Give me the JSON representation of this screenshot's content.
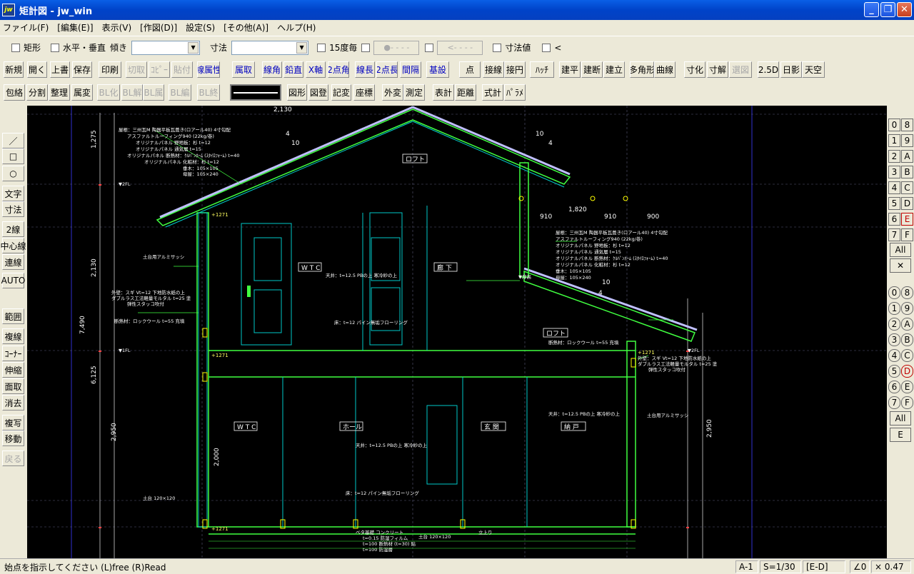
{
  "window": {
    "icon_label": "jw",
    "title": "矩計図 - jw_win",
    "min": "_",
    "max": "❐",
    "close": "✕"
  },
  "menu": [
    "ファイル(F)",
    "[編集(E)]",
    "表示(V)",
    "[作図(D)]",
    "設定(S)",
    "[その他(A)]",
    "ヘルプ(H)"
  ],
  "row1": {
    "kukei": "矩形",
    "suihei": "水平・垂直",
    "katamuki": "傾き",
    "sunpo": "寸法",
    "deg15": "15度毎",
    "dis1": "●- - - -",
    "dis2": "<- - - -",
    "sunpochi": "寸法値",
    "lt": "<"
  },
  "toolbar2": [
    "新規",
    "開く",
    "上書",
    "保存",
    "印刷",
    "切取",
    "ｺﾋﾟｰ",
    "貼付",
    "線属性",
    "属取",
    "線角",
    "鉛直",
    "X軸",
    "2点角",
    "線長",
    "2点長",
    "間隔",
    "基設",
    "点",
    "接線",
    "接円",
    "ﾊｯﾁ",
    "建平",
    "建断",
    "建立",
    "多角形",
    "曲線",
    "寸化",
    "寸解",
    "選図",
    "2.5D",
    "日影",
    "天空"
  ],
  "toolbar3": [
    "包絡",
    "分割",
    "整理",
    "属変",
    "BL化",
    "BL解",
    "BL属",
    "BL編",
    "BL終",
    "図形",
    "図登",
    "記変",
    "座標",
    "外変",
    "測定",
    "表計",
    "距離",
    "式計",
    "ﾊﾟﾗﾒ"
  ],
  "leftbar": [
    "／",
    "□",
    "○",
    "文字",
    "寸法",
    "2線",
    "中心線",
    "連線",
    "AUTO",
    "範囲",
    "複線",
    "ｺｰﾅｰ",
    "伸縮",
    "面取",
    "消去",
    "複写",
    "移動",
    "戻る"
  ],
  "layers": {
    "groups_a": [
      "0",
      "1",
      "2",
      "3",
      "4",
      "5",
      "6",
      "7"
    ],
    "groups_b": [
      "8",
      "9",
      "A",
      "B",
      "C",
      "D",
      "E",
      "F"
    ],
    "all_label": "All",
    "x_label": "✕",
    "e_label": "E"
  },
  "drawing": {
    "dim_top": "2,130",
    "dim_left_1": "1,275",
    "dim_left_2": "2,130",
    "dim_left_3": "7,490",
    "dim_left_4": "6,125",
    "dim_left_5": "2,950",
    "dim_left_6": "2,000",
    "dim_right_1": "910",
    "dim_right_2": "910",
    "dim_right_3": "900",
    "dim_1820": "1,820",
    "dim_right_v": "2,950",
    "slope1": "4",
    "slope2": "10",
    "slope3": "10",
    "slope4": "4",
    "slope5": "10",
    "slope6": "4",
    "room_wtc_up": "W T C",
    "room_roka": "廊 下",
    "room_loft_top": "ロフト",
    "room_loft_right": "ロフト",
    "room_wtc_down": "W T C",
    "room_hall": "ホール",
    "room_genkan1": "玄 関",
    "room_genkan2": "納 戸",
    "note_roof": "屋根：三州瓦M 陶器平板瓦葺き(ロアール40) 4寸勾配",
    "note_roof2": "アスファルトルーフィング940 (22kg/巻)",
    "note_roof3": "オリジナルパネル 野地板：杉 t=12",
    "note_roof4": "オリジナルパネル 通気層 t=15",
    "note_roof5": "オリジナルパネル 断熱材：ｸﾙﾊﾟﾝﾎｰﾑ (ｽﾀｲﾛﾌｫｰﾑ) t=40",
    "note_roof6": "オリジナルパネル 化粧材：杉 t=12",
    "note_roof7": "垂木：105×105",
    "note_roof8": "母屋：105×240",
    "note_fl1": "▼1FL",
    "note_fl2": "▼2FL",
    "note_fl_r": "▼2FL",
    "note_sash": "土台用アルミサッシ",
    "note_wall": "外壁：スギ Vt=12 下地防水紙の上",
    "note_wall2": "ダブルラス工法軽量モルタル t=25 塗",
    "note_wall3": "弾性スタッコ吹付",
    "note_ins": "断熱材：ロックウール t=55 充填",
    "note_door": "▼扉高",
    "note_ceil": "天井：t=12.5 PBの上 寒冷紗の上",
    "note_floor": "床：t=12 パイン無垢フローリング",
    "note_dodai": "土台 120×120",
    "note_bottom": "ベタ基礎 コンクリート",
    "note_bottom2": "t=0.15 防湿フィルム",
    "note_bottom3": "t=100 断熱材 (t=30) 貼",
    "note_bottom4": "t=100 防湿層",
    "note_dodai2": "土台 120×120",
    "note_kiso": "立上り"
  },
  "status": {
    "message": "始点を指示してください (L)free (R)Read",
    "paper": "A-1",
    "scale": "S=1/30",
    "layer": "[E-D]",
    "angle": "∠0",
    "zoom": "× 0.47"
  }
}
